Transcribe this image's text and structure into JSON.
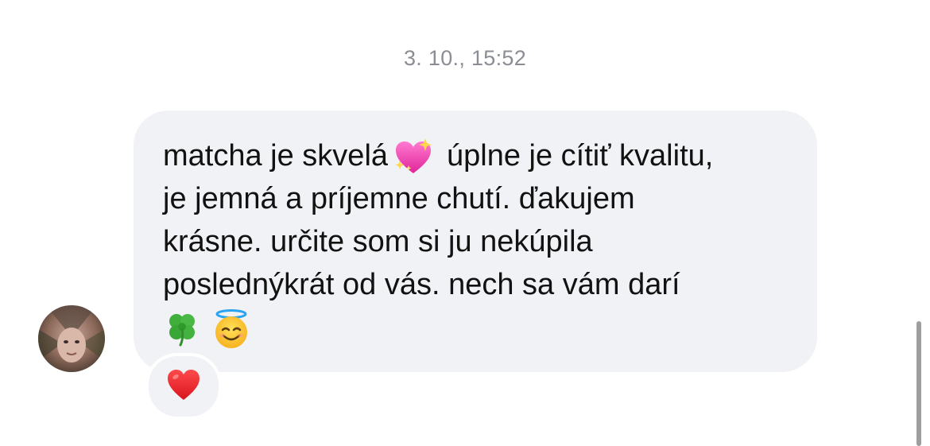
{
  "conversation": {
    "timestamp": "3. 10., 15:52"
  },
  "message": {
    "lines": [
      "matcha je skvelá",
      "úplne je cítiť kvalitu,",
      "je jemná a príjemne chutí. ďakujem",
      "krásne. určite som si ju nekúpila",
      "poslednýkrát od vás. nech sa vám darí"
    ],
    "emojis": {
      "sparkling_heart": "sparkling-heart-icon",
      "clover": "four-leaf-clover-icon",
      "halo_smile": "smiling-face-with-halo-icon"
    }
  },
  "reaction": {
    "emoji": "red-heart-icon"
  },
  "colors": {
    "bubble_bg": "#f1f2f5",
    "timestamp": "#8a8d93",
    "text": "#121212",
    "heart": "#e8202e"
  }
}
